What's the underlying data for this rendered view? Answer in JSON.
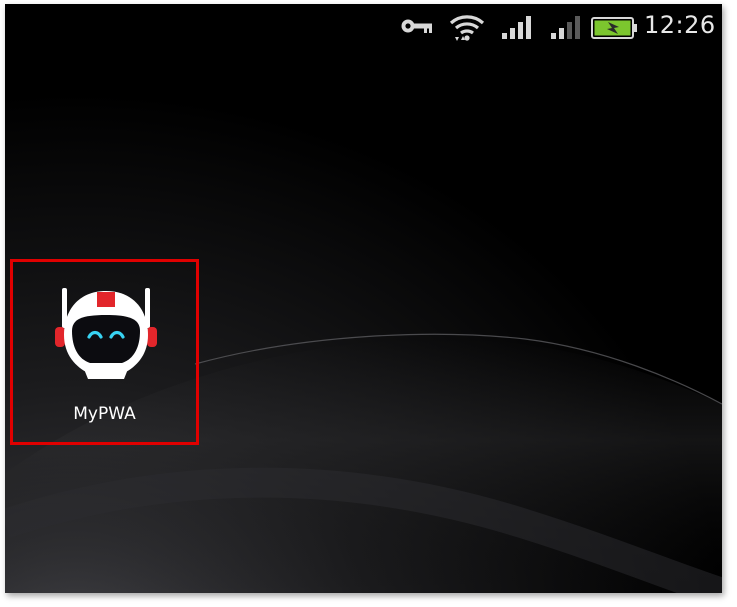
{
  "status_bar": {
    "time": "12:26",
    "icons": [
      "vpn-key-icon",
      "wifi-icon",
      "signal-icon",
      "signal-icon",
      "battery-charging-icon"
    ],
    "battery_color": "#7cc62e"
  },
  "home_screen": {
    "shortcut": {
      "label": "MyPWA",
      "icon": "astronaut-helmet-icon",
      "highlight_color": "#e00000"
    }
  }
}
